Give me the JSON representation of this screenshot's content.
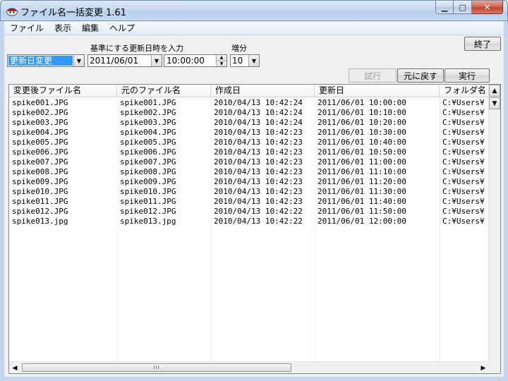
{
  "window": {
    "title": "ファイル名一括変更 1.61",
    "min_glyph": "▁",
    "max_glyph": "□",
    "close_glyph": "✕"
  },
  "menu": {
    "items": [
      "ファイル",
      "表示",
      "編集",
      "ヘルプ"
    ]
  },
  "toolbar": {
    "exit_label": "終了",
    "base_datetime_label": "基準にする更新日時を入力",
    "increment_label": "増分",
    "mode_value": "更新日変更",
    "date_value": "2011/06/01",
    "time_value": "10:00:00",
    "increment_value": "10",
    "trial_label": "試行",
    "revert_label": "元に戻す",
    "execute_label": "実行"
  },
  "list": {
    "columns": [
      "変更後ファイル名",
      "元のファイル名",
      "作成日",
      "更新日",
      "フォルダ名"
    ],
    "rows": [
      [
        "spike001.JPG",
        "spike001.JPG",
        "2010/04/13  10:42:24",
        "2011/06/01  10:00:00",
        "C:¥Users¥"
      ],
      [
        "spike002.JPG",
        "spike002.JPG",
        "2010/04/13  10:42:24",
        "2011/06/01  10:10:00",
        "C:¥Users¥"
      ],
      [
        "spike003.JPG",
        "spike003.JPG",
        "2010/04/13  10:42:24",
        "2011/06/01  10:20:00",
        "C:¥Users¥"
      ],
      [
        "spike004.JPG",
        "spike004.JPG",
        "2010/04/13  10:42:23",
        "2011/06/01  10:30:00",
        "C:¥Users¥"
      ],
      [
        "spike005.JPG",
        "spike005.JPG",
        "2010/04/13  10:42:23",
        "2011/06/01  10:40:00",
        "C:¥Users¥"
      ],
      [
        "spike006.JPG",
        "spike006.JPG",
        "2010/04/13  10:42:23",
        "2011/06/01  10:50:00",
        "C:¥Users¥"
      ],
      [
        "spike007.JPG",
        "spike007.JPG",
        "2010/04/13  10:42:23",
        "2011/06/01  11:00:00",
        "C:¥Users¥"
      ],
      [
        "spike008.JPG",
        "spike008.JPG",
        "2010/04/13  10:42:23",
        "2011/06/01  11:10:00",
        "C:¥Users¥"
      ],
      [
        "spike009.JPG",
        "spike009.JPG",
        "2010/04/13  10:42:23",
        "2011/06/01  11:20:00",
        "C:¥Users¥"
      ],
      [
        "spike010.JPG",
        "spike010.JPG",
        "2010/04/13  10:42:23",
        "2011/06/01  11:30:00",
        "C:¥Users¥"
      ],
      [
        "spike011.JPG",
        "spike011.JPG",
        "2010/04/13  10:42:23",
        "2011/06/01  11:40:00",
        "C:¥Users¥"
      ],
      [
        "spike012.JPG",
        "spike012.JPG",
        "2010/04/13  10:42:22",
        "2011/06/01  11:50:00",
        "C:¥Users¥"
      ],
      [
        "spike013.jpg",
        "spike013.jpg",
        "2010/04/13  10:42:22",
        "2011/06/01  12:00:00",
        "C:¥Users¥"
      ]
    ],
    "hscroll_grip": "III"
  }
}
